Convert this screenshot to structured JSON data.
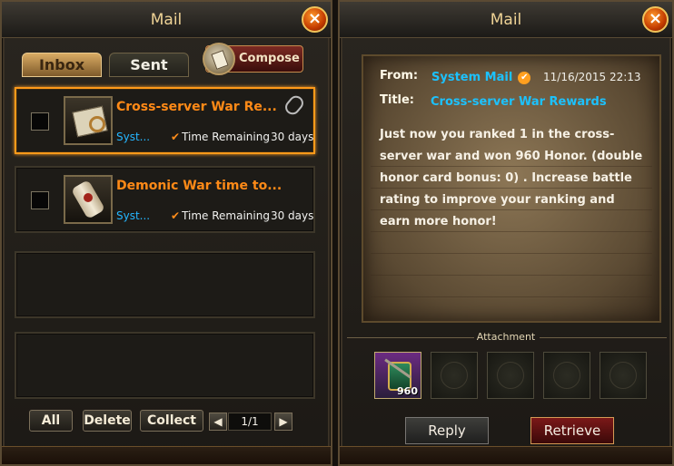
{
  "left": {
    "title": "Mail",
    "tabs": [
      {
        "label": "Inbox",
        "active": true
      },
      {
        "label": "Sent",
        "active": false
      }
    ],
    "compose_label": "Compose",
    "mails": [
      {
        "subject": "Cross-server War Re...",
        "sender": "Syst...",
        "remaining_label": "Time Remaining",
        "remaining_value": "30 days",
        "icon": "map-icon",
        "has_attachment": true
      },
      {
        "subject": "Demonic War time to...",
        "sender": "Syst...",
        "remaining_label": "Time Remaining",
        "remaining_value": "30 days",
        "icon": "scroll-icon",
        "has_attachment": false
      }
    ],
    "buttons": {
      "all": "All",
      "delete": "Delete",
      "collect": "Collect"
    },
    "pager": {
      "prev": "◀",
      "page": "1/1",
      "next": "▶"
    }
  },
  "right": {
    "title": "Mail",
    "from_label": "From:",
    "from_value": "System Mail",
    "date": "11/16/2015 22:13",
    "title_label": "Title:",
    "title_value": "Cross-server War Rewards",
    "body": "Just now you ranked 1 in the cross-server war and won 960 Honor. (double honor card bonus: 0) . Increase battle rating to improve your ranking and earn more honor!",
    "attachment_label": "Attachment",
    "attachment": {
      "quantity": "960"
    },
    "reply_label": "Reply",
    "retrieve_label": "Retrieve"
  },
  "colors": {
    "accent_orange": "#ff8a17",
    "sender_blue": "#25b6ff",
    "detail_blue": "#1cc2ff",
    "frame": "#5a4a33",
    "paper": "#7a664a"
  }
}
